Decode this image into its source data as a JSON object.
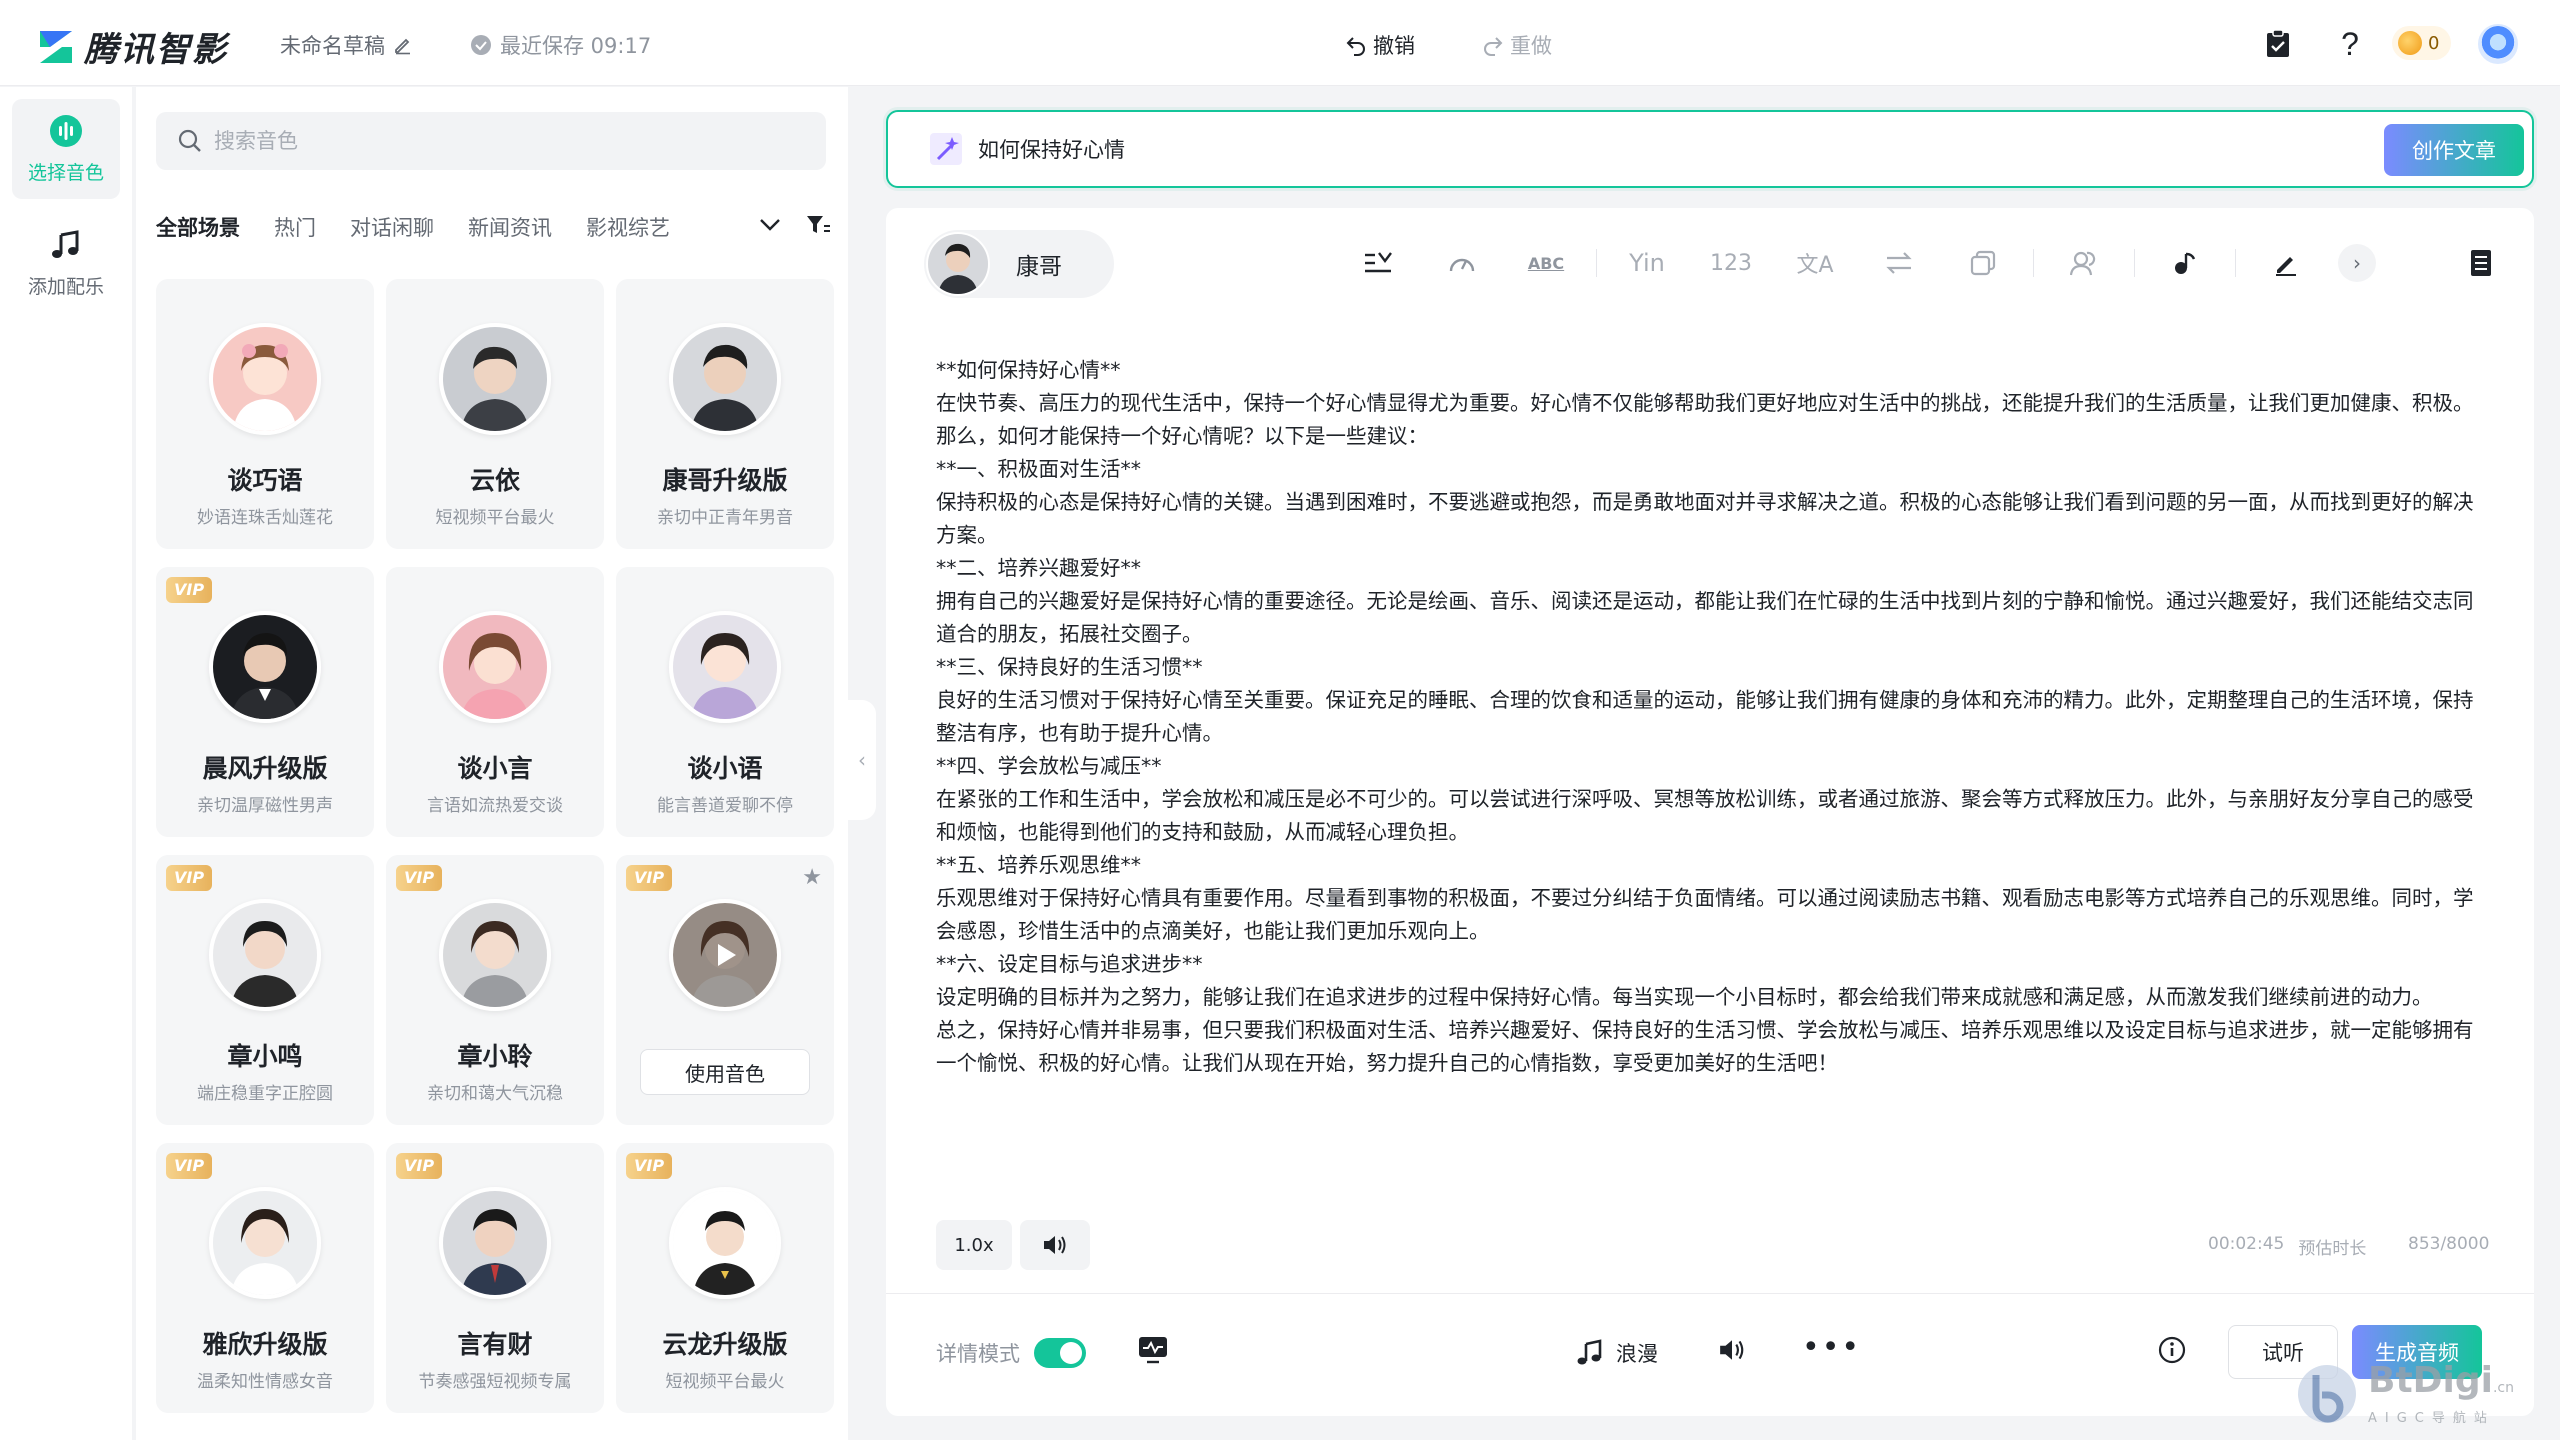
{
  "header": {
    "brand": "腾讯智影",
    "draft_name": "未命名草稿",
    "save_status": "最近保存 09:17",
    "undo_label": "撤销",
    "redo_label": "重做",
    "coins": "0"
  },
  "rail": {
    "items": [
      {
        "label": "选择音色",
        "icon": "waveform-icon"
      },
      {
        "label": "添加配乐",
        "icon": "music-note-icon"
      }
    ]
  },
  "voice_panel": {
    "search_placeholder": "搜索音色",
    "tabs": [
      "全部场景",
      "热门",
      "对话闲聊",
      "新闻资讯",
      "影视综艺"
    ],
    "vip_label": "VIP",
    "use_voice_label": "使用音色",
    "cards": [
      {
        "name": "谈巧语",
        "desc": "妙语连珠舌灿莲花",
        "vip": false
      },
      {
        "name": "云依",
        "desc": "短视频平台最火",
        "vip": false
      },
      {
        "name": "康哥升级版",
        "desc": "亲切中正青年男音",
        "vip": false
      },
      {
        "name": "晨风升级版",
        "desc": "亲切温厚磁性男声",
        "vip": true
      },
      {
        "name": "谈小言",
        "desc": "言语如流热爱交谈",
        "vip": false
      },
      {
        "name": "谈小语",
        "desc": "能言善道爱聊不停",
        "vip": false
      },
      {
        "name": "章小鸣",
        "desc": "端庄稳重字正腔圆",
        "vip": true
      },
      {
        "name": "章小聆",
        "desc": "亲切和蔼大气沉稳",
        "vip": true
      },
      {
        "name": "",
        "desc": "",
        "vip": true
      },
      {
        "name": "雅欣升级版",
        "desc": "温柔知性情感女音",
        "vip": true
      },
      {
        "name": "言有财",
        "desc": "节奏感强短视频专属",
        "vip": true
      },
      {
        "name": "云龙升级版",
        "desc": "短视频平台最火",
        "vip": true
      }
    ]
  },
  "topic": {
    "value": "如何保持好心情",
    "create_label": "创作文章"
  },
  "editor": {
    "speaker": "康哥",
    "tools": [
      "insert-pause-icon",
      "speed-gauge-icon",
      "ABC",
      "Yin",
      "123",
      "文A",
      "replace-icon",
      "copy-icon",
      "multi-speaker-icon",
      "music-icon",
      "edit-icon"
    ],
    "article": [
      "**如何保持好心情**",
      "在快节奏、高压力的现代生活中，保持一个好心情显得尤为重要。好心情不仅能够帮助我们更好地应对生活中的挑战，还能提升我们的生活质量，让我们更加健康、积极。那么，如何才能保持一个好心情呢？以下是一些建议：",
      "**一、积极面对生活**",
      "保持积极的心态是保持好心情的关键。当遇到困难时，不要逃避或抱怨，而是勇敢地面对并寻求解决之道。积极的心态能够让我们看到问题的另一面，从而找到更好的解决方案。",
      "**二、培养兴趣爱好**",
      "拥有自己的兴趣爱好是保持好心情的重要途径。无论是绘画、音乐、阅读还是运动，都能让我们在忙碌的生活中找到片刻的宁静和愉悦。通过兴趣爱好，我们还能结交志同道合的朋友，拓展社交圈子。",
      "**三、保持良好的生活习惯**",
      "良好的生活习惯对于保持好心情至关重要。保证充足的睡眠、合理的饮食和适量的运动，能够让我们拥有健康的身体和充沛的精力。此外，定期整理自己的生活环境，保持整洁有序，也有助于提升心情。",
      "**四、学会放松与减压**",
      "在紧张的工作和生活中，学会放松和减压是必不可少的。可以尝试进行深呼吸、冥想等放松训练，或者通过旅游、聚会等方式释放压力。此外，与亲朋好友分享自己的感受和烦恼，也能得到他们的支持和鼓励，从而减轻心理负担。",
      "**五、培养乐观思维**",
      "乐观思维对于保持好心情具有重要作用。尽量看到事物的积极面，不要过分纠结于负面情绪。可以通过阅读励志书籍、观看励志电影等方式培养自己的乐观思维。同时，学会感恩，珍惜生活中的点滴美好，也能让我们更加乐观向上。",
      "**六、设定目标与追求进步**",
      "设定明确的目标并为之努力，能够让我们在追求进步的过程中保持好心情。每当实现一个小目标时，都会给我们带来成就感和满足感，从而激发我们继续前进的动力。",
      "总之，保持好心情并非易事，但只要我们积极面对生活、培养兴趣爱好、保持良好的生活习惯、学会放松与减压、培养乐观思维以及设定目标与追求进步，就一定能够拥有一个愉悦、积极的好心情。让我们从现在开始，努力提升自己的心情指数，享受更加美好的生活吧！"
    ],
    "speed": "1.0x",
    "duration": "00:02:45",
    "duration_label": "预估时长",
    "char_count": "853/8000"
  },
  "bottom": {
    "detail_mode_label": "详情模式",
    "bgm_label": "浪漫",
    "try_label": "试听",
    "generate_label": "生成音频"
  },
  "watermark": {
    "name": "BtDigi",
    "suffix": ".cn",
    "tagline": "AIGC导航站"
  },
  "colors": {
    "accent": "#14c59a",
    "accent_gradient_start": "#7b8bff"
  }
}
